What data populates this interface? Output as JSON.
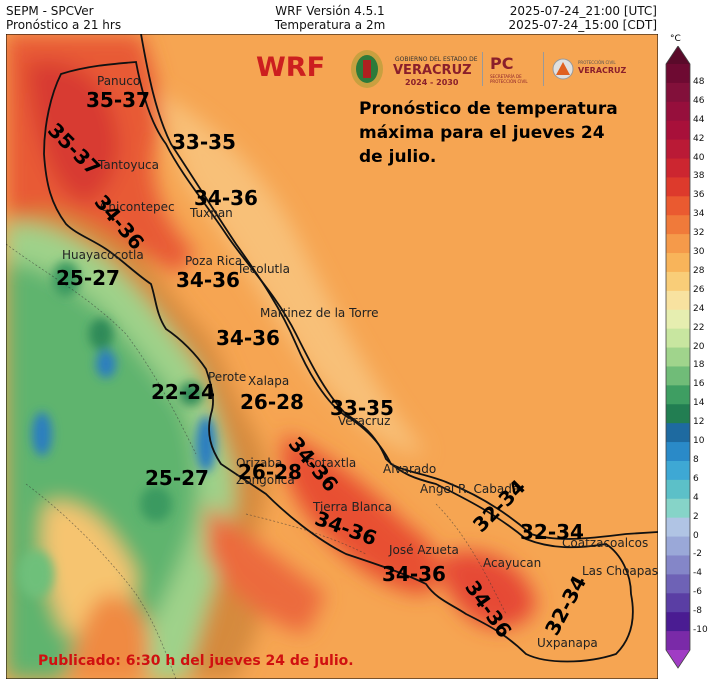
{
  "header": {
    "left_line1": "SEPM - SPCVer",
    "left_line2": "Pronóstico a 21 hrs",
    "center_line1": "WRF Versión 4.5.1",
    "center_line2": "Temperatura a 2m",
    "right_line1": "2025-07-24_21:00 [UTC]",
    "right_line2": "2025-07-24_15:00 [CDT]"
  },
  "map": {
    "model_label": "WRF",
    "description": "Pronóstico de temperatura máxima para el jueves 24 de julio.",
    "published": "Publicado: 6:30 h del jueves 24 de julio.",
    "cities": [
      {
        "name": "Panuco"
      },
      {
        "name": "Tantoyuca"
      },
      {
        "name": "Chicontepec"
      },
      {
        "name": "Tuxpan"
      },
      {
        "name": "Huayacocotla"
      },
      {
        "name": "Poza Rica"
      },
      {
        "name": "Tecolutla"
      },
      {
        "name": "Martinez de la Torre"
      },
      {
        "name": "Perote"
      },
      {
        "name": "Xalapa"
      },
      {
        "name": "Veracruz"
      },
      {
        "name": "Orizaba"
      },
      {
        "name": "Zongolica"
      },
      {
        "name": "Cotaxtla"
      },
      {
        "name": "Alvarado"
      },
      {
        "name": "Angel R. Cabada"
      },
      {
        "name": "Tierra Blanca"
      },
      {
        "name": "José Azueta"
      },
      {
        "name": "Acayucan"
      },
      {
        "name": "Coatzacoalcos"
      },
      {
        "name": "Las Choapas"
      },
      {
        "name": "Uxpanapa"
      }
    ],
    "ranges": [
      "35-37",
      "35-37",
      "33-35",
      "34-36",
      "34-36",
      "25-27",
      "34-36",
      "34-36",
      "22-24",
      "26-28",
      "33-35",
      "34-36",
      "25-27",
      "26-28",
      "34-36",
      "32-34",
      "32-34",
      "34-36",
      "34-36",
      "32-34"
    ]
  },
  "logos": {
    "gov_line1": "GOBIERNO DEL ESTADO DE",
    "gov_line2": "VERACRUZ",
    "gov_line3": "2024 - 2030",
    "pc_label": "PC",
    "pc_sub": "SECRETARÍA DE PROTECCIÓN CIVIL",
    "pc2_line1": "PROTECCIÓN CIVIL",
    "pc2_line2": "VERACRUZ"
  },
  "colorbar": {
    "unit": "°C",
    "ticks": [
      48,
      46,
      44,
      42,
      40,
      38,
      36,
      34,
      32,
      30,
      28,
      26,
      24,
      22,
      20,
      18,
      16,
      14,
      12,
      10,
      8,
      6,
      4,
      2,
      0,
      -2,
      -4,
      -6,
      -8,
      -10
    ],
    "colors": [
      "#5a0a2a",
      "#6e0a32",
      "#82103a",
      "#960f3c",
      "#a8103a",
      "#ba1a36",
      "#cc2630",
      "#dd3a2c",
      "#ea5a30",
      "#f07a3a",
      "#f59a4a",
      "#f8b45a",
      "#f9cd78",
      "#f8e2a0",
      "#e6eeb0",
      "#c8e6a0",
      "#a0d48c",
      "#70bc78",
      "#3e9e62",
      "#227e52",
      "#1e6aa0",
      "#2a8ac8",
      "#3ea8d4",
      "#5cc0c8",
      "#86d4c8",
      "#b0c4e4",
      "#9aa8d8",
      "#8486c8",
      "#6e62b6",
      "#5a3ea4",
      "#4a1c92",
      "#7a2aa8",
      "#a03cc4"
    ]
  }
}
